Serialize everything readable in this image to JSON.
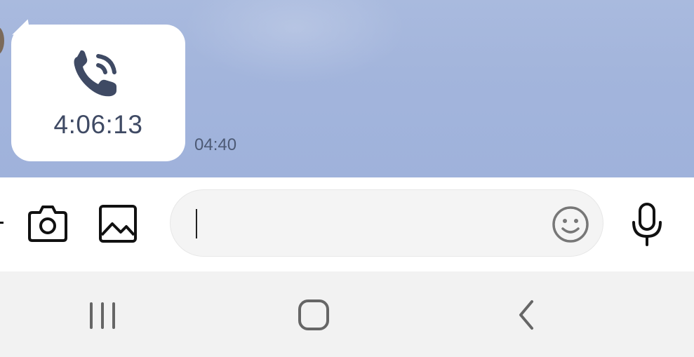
{
  "chat": {
    "call_message": {
      "icon": "voice-call-icon",
      "duration": "4:06:13",
      "time": "04:40"
    }
  },
  "input_bar": {
    "camera_icon": "camera-icon",
    "gallery_icon": "image-icon",
    "message_value": "",
    "emoji_icon": "smiley-icon",
    "mic_icon": "microphone-icon"
  },
  "nav_bar": {
    "recent_icon": "recent-apps-icon",
    "home_icon": "home-icon",
    "back_icon": "back-icon"
  },
  "colors": {
    "chat_background": "#a3b5dc",
    "bubble": "#ffffff",
    "call_icon": "#3f4a64",
    "input_background": "#f4f4f4",
    "nav_background": "#f2f2f2"
  }
}
